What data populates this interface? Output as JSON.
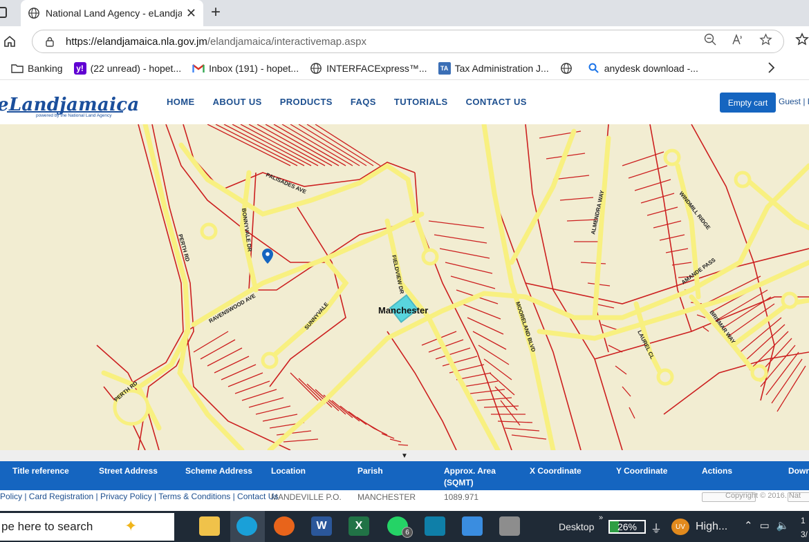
{
  "browser": {
    "tab_title": "National Land Agency - eLandjam",
    "tab_close": "✕",
    "new_tab": "+",
    "url_host": "https://elandjamaica.nla.gov.jm",
    "url_path": "/elandjamaica/interactivemap.aspx",
    "bookmarks": [
      {
        "label": "Banking",
        "icon": "folder-icon"
      },
      {
        "label": "(22 unread) - hopet...",
        "icon": "yahoo-icon"
      },
      {
        "label": "Inbox (191) - hopet...",
        "icon": "gmail-icon"
      },
      {
        "label": "INTERFACExpress™...",
        "icon": "globe-icon"
      },
      {
        "label": "Tax Administration J...",
        "icon": "tax-icon"
      },
      {
        "label": "",
        "icon": "globe-icon"
      },
      {
        "label": "anydesk download -...",
        "icon": "search-icon"
      }
    ]
  },
  "site": {
    "logo": "eLandjamaica",
    "logo_sub": "powered by the National Land Agency",
    "nav": [
      "HOME",
      "ABOUT US",
      "PRODUCTS",
      "FAQS",
      "TUTORIALS",
      "CONTACT US"
    ],
    "cart_button": "Empty cart",
    "user_links": "Guest | L"
  },
  "map": {
    "label_parish": "Manchester",
    "street_labels": [
      "PALISADES AVE",
      "BONNYVALE DR",
      "PERTH RD",
      "RAVENSWOOD AVE",
      "SUNNYVALE",
      "FIELDVIEW DR",
      "MOORELAND BLVD",
      "ALMENDRA WAY",
      "WINDMILL RIDGE",
      "AMANDE PASS",
      "LAUREL CL",
      "BRISMAR WAY",
      "PERTH RD"
    ],
    "toggle_glyph": "▼",
    "road_color": "#f8f080",
    "parcel_color": "#cc1f1f",
    "highlight_color": "#49d3e0"
  },
  "grid": {
    "headers": [
      "Title reference",
      "Street Address",
      "Scheme Address",
      "Location",
      "Parish",
      "Approx. Area (SQMT)",
      "X Coordinate",
      "Y Coordinate",
      "Actions",
      "Down"
    ],
    "row": {
      "location": "MANDEVILLE P.O.",
      "parish": "MANCHESTER",
      "area": "1089.971"
    },
    "footer_links": "Policy | Card Registration | Privacy Policy | Terms & Conditions | Contact Us",
    "copyright": "Copyright © 2016. Nat"
  },
  "taskbar": {
    "search_placeholder": "pe here to search",
    "desktop_label": "Desktop",
    "battery": "26%",
    "battery_level": 0.26,
    "weather_badge": "UV",
    "weather_text": "High...",
    "whatsapp_badge": "6",
    "clock_line1": "1",
    "clock_line2": "3/"
  }
}
